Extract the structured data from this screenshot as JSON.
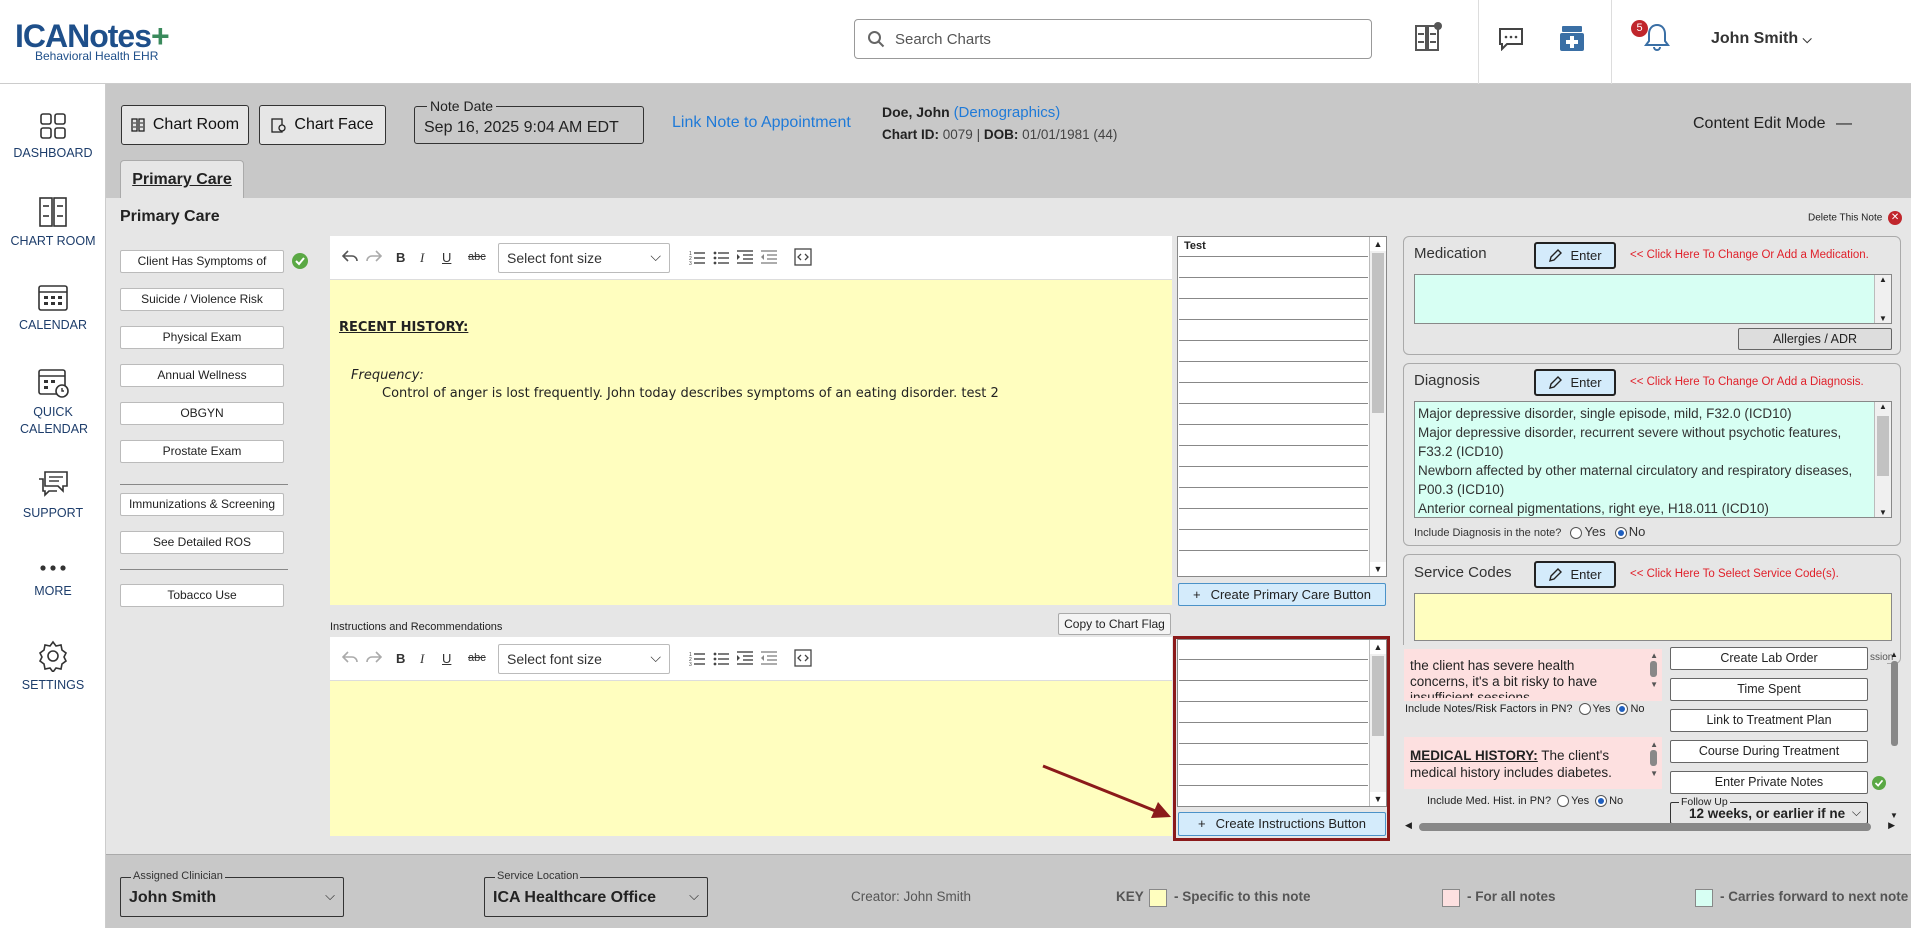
{
  "logo": {
    "brand": "ICANotes",
    "plus": "+",
    "tagline": "Behavioral Health EHR"
  },
  "search": {
    "placeholder": "Search Charts"
  },
  "header": {
    "notification_count": "5",
    "user_name": "John Smith"
  },
  "leftnav": [
    {
      "label": "DASHBOARD",
      "icon": "dashboard-icon"
    },
    {
      "label": "CHART ROOM",
      "icon": "chart-room-icon"
    },
    {
      "label": "CALENDAR",
      "icon": "calendar-icon"
    },
    {
      "label": "QUICK CALENDAR",
      "icon": "quick-calendar-icon"
    },
    {
      "label": "SUPPORT",
      "icon": "support-icon"
    },
    {
      "label": "MORE",
      "icon": "more-icon"
    },
    {
      "label": "SETTINGS",
      "icon": "settings-icon"
    }
  ],
  "toolbar": {
    "chart_room": "Chart Room",
    "chart_face": "Chart Face",
    "note_date_label": "Note Date",
    "note_date": "Sep 16, 2025 9:04 AM EDT",
    "link_appointment": "Link Note to Appointment",
    "content_edit_mode": "Content Edit Mode"
  },
  "patient": {
    "name": "Doe, John",
    "demographics": "(Demographics)",
    "chart_id_label": "Chart ID:",
    "chart_id": "0079",
    "dob_label": "DOB:",
    "dob": "01/01/1981 (44)"
  },
  "tabs": {
    "primary_care": "Primary Care"
  },
  "section": {
    "title": "Primary Care",
    "delete_note": "Delete This Note"
  },
  "side_buttons": [
    "Client Has Symptoms of",
    "Suicide / Violence Risk",
    "Physical Exam",
    "Annual Wellness",
    "OBGYN",
    "Prostate Exam",
    "Immunizations & Screening",
    "See Detailed ROS",
    "Tobacco Use"
  ],
  "editor": {
    "font_select": "Select font size",
    "heading": "RECENT HISTORY:",
    "freq_label": "Frequency:",
    "freq_text": "Control of anger is lost frequently. John today describes symptoms of an eating disorder. test 2"
  },
  "grid1": {
    "header": "Test",
    "create_button": "Create Primary Care Button"
  },
  "instructions": {
    "label": "Instructions and Recommendations",
    "copy_flag": "Copy to Chart Flag",
    "create_button": "Create Instructions Button"
  },
  "medication": {
    "title": "Medication",
    "enter": "Enter",
    "hint": "<< Click Here To Change Or Add a Medication.",
    "allergies": "Allergies / ADR"
  },
  "diagnosis": {
    "title": "Diagnosis",
    "enter": "Enter",
    "hint": "<< Click Here To Change Or Add a Diagnosis.",
    "items": [
      "Major depressive disorder, single episode, mild, F32.0 (ICD10)",
      "Major depressive disorder, recurrent severe without psychotic features, F33.2 (ICD10)",
      "Newborn affected by other maternal circulatory and respiratory diseases, P00.3 (ICD10)",
      "Anterior corneal pigmentations, right eye, H18.011 (ICD10)"
    ],
    "include_label": "Include Diagnosis in the note?",
    "yes": "Yes",
    "no": "No"
  },
  "service_codes": {
    "title": "Service Codes",
    "enter": "Enter",
    "hint": "<< Click Here To Select Service Code(s).",
    "partial": "ssion"
  },
  "notes": {
    "risk_text": "the client has severe health concerns, it's a bit risky to have insufficient sessions",
    "risk_include": "Include Notes/Risk Factors in PN?",
    "med_heading": "MEDICAL HISTORY:",
    "med_text": " The client's medical history includes diabetes.",
    "med_include": "Include Med. Hist. in PN?",
    "yes": "Yes",
    "no": "No"
  },
  "actions": {
    "lab": "Create Lab Order",
    "time": "Time Spent",
    "link_plan": "Link to Treatment Plan",
    "course": "Course During Treatment",
    "private": "Enter Private Notes",
    "follow_label": "Follow Up",
    "follow_value": "12 weeks, or earlier if ne"
  },
  "footer": {
    "clinician_label": "Assigned Clinician",
    "clinician": "John Smith",
    "location_label": "Service Location",
    "location": "ICA Healthcare Office",
    "creator": "Creator: John Smith",
    "key": "KEY",
    "key_yellow": "- Specific to this note",
    "key_pink": "- For all notes",
    "key_cyan": "- Carries forward to next note"
  },
  "colors": {
    "yellow": "#fffebf",
    "pink": "#fde0e0",
    "cyan": "#d7fff3",
    "annotation": "#8b1a1a",
    "link": "#1f7ad8"
  }
}
